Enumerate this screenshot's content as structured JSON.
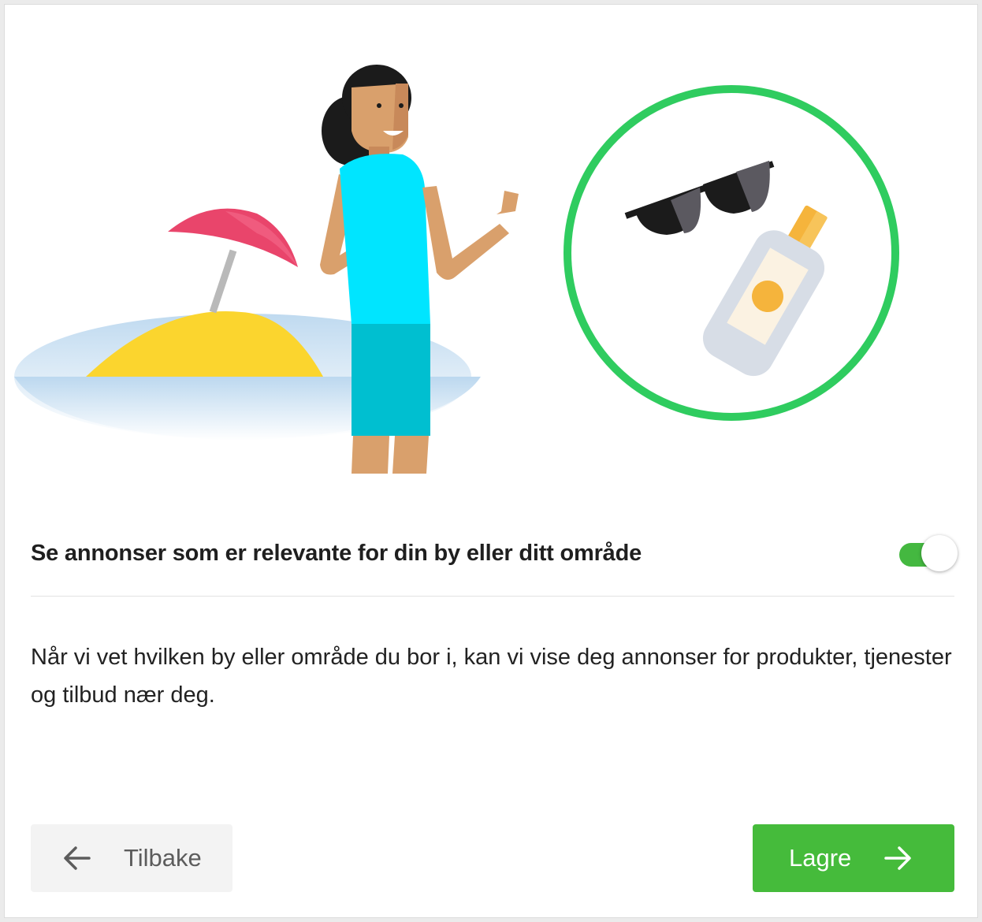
{
  "setting": {
    "title": "Se annonser som er relevante for din by eller ditt område",
    "enabled": true
  },
  "description": "Når vi vet hvilken by eller område du bor i, kan vi vise deg annonser for produkter, tjenester og tilbud nær deg.",
  "buttons": {
    "back_label": "Tilbake",
    "save_label": "Lagre"
  },
  "icons": {
    "back": "arrow-left-icon",
    "save": "arrow-right-icon"
  },
  "colors": {
    "accent": "#45bb3b",
    "toggle_on": "#44b840",
    "circle": "#2fcc5f"
  }
}
